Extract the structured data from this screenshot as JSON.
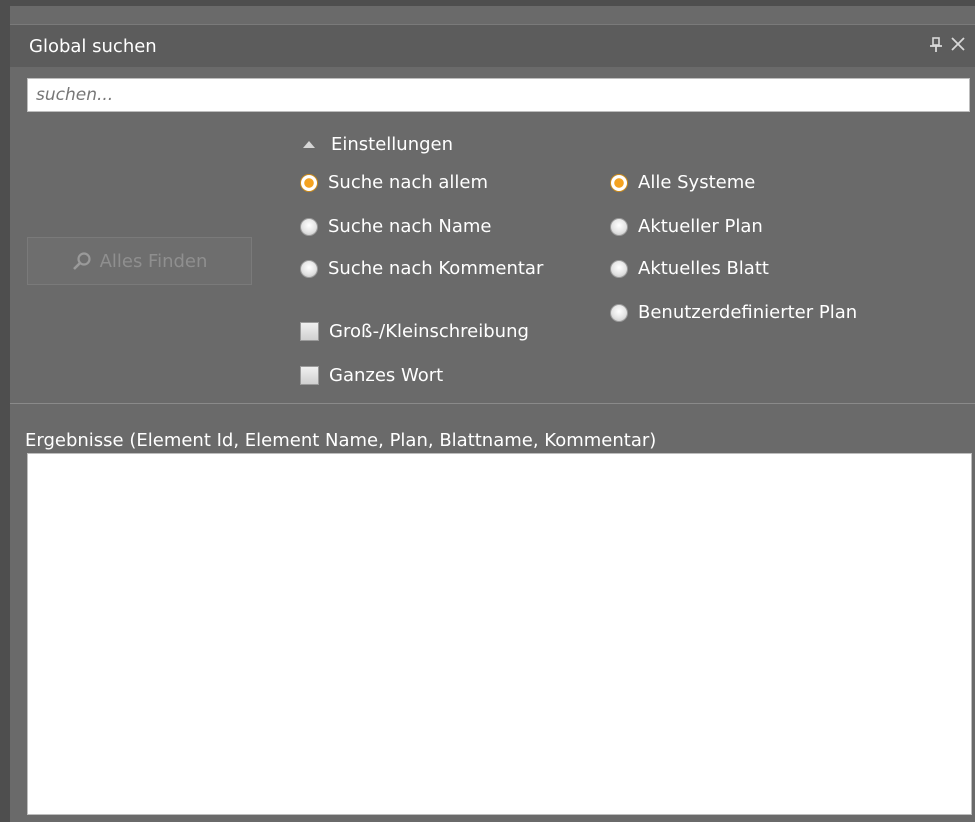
{
  "window": {
    "title": "Global suchen"
  },
  "search": {
    "placeholder": "suchen..."
  },
  "find_button": {
    "label": "Alles Finden",
    "icon": "search-icon"
  },
  "settings": {
    "label": "Einstellungen",
    "expanded": true
  },
  "search_mode": {
    "options": [
      {
        "label": "Suche nach allem",
        "checked": true
      },
      {
        "label": "Suche nach Name",
        "checked": false
      },
      {
        "label": "Suche nach Kommentar",
        "checked": false
      }
    ]
  },
  "scope": {
    "options": [
      {
        "label": "Alle Systeme",
        "checked": true
      },
      {
        "label": "Aktueller Plan",
        "checked": false
      },
      {
        "label": "Aktuelles Blatt",
        "checked": false
      },
      {
        "label": "Benutzerdefinierter Plan",
        "checked": false
      }
    ]
  },
  "checkboxes": [
    {
      "label": "Groß-/Kleinschreibung",
      "checked": false
    },
    {
      "label": "Ganzes Wort",
      "checked": false
    }
  ],
  "results": {
    "label": "Ergebnisse (Element Id, Element Name, Plan, Blattname, Kommentar)"
  },
  "colors": {
    "panel_bg": "#6a6a6a",
    "titlebar_bg": "#5c5c5c",
    "accent_radio": "#f4a21f"
  }
}
